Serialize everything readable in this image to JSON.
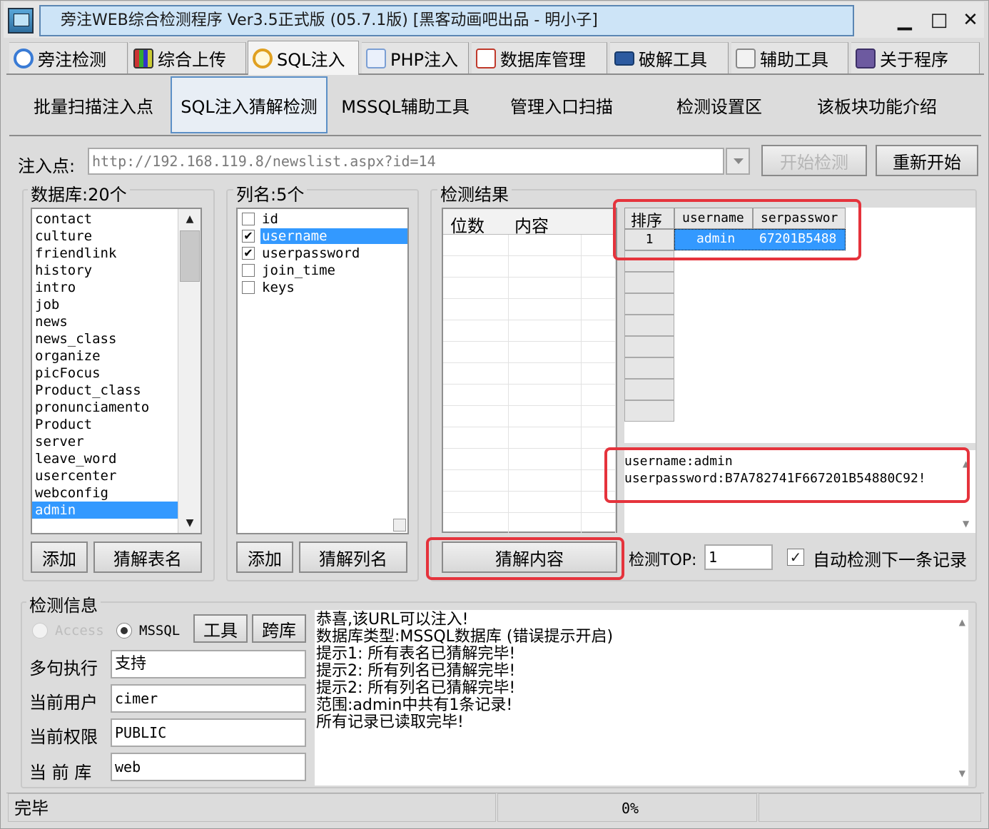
{
  "window": {
    "title": "旁注WEB综合检测程序 Ver3.5正式版 (05.7.1版) [黑客动画吧出品 - 明小子]",
    "minimize": "▁",
    "maximize": "□",
    "close": "✕"
  },
  "main_tabs": [
    {
      "label": "旁注检测",
      "icon_color": "#3a7bd5"
    },
    {
      "label": "综合上传",
      "icon_color": "#4a6fa5"
    },
    {
      "label": "SQL注入",
      "icon_color": "#e0a020"
    },
    {
      "label": "PHP注入",
      "icon_color": "#7b9fd4"
    },
    {
      "label": "数据库管理",
      "icon_color": "#c0392b"
    },
    {
      "label": "破解工具",
      "icon_color": "#2c5aa0"
    },
    {
      "label": "辅助工具",
      "icon_color": "#888888"
    },
    {
      "label": "关于程序",
      "icon_color": "#6d5aa0"
    }
  ],
  "sub_tabs": [
    "批量扫描注入点",
    "SQL注入猜解检测",
    "MSSQL辅助工具",
    "管理入口扫描",
    "检测设置区",
    "该板块功能介绍"
  ],
  "injection": {
    "label": "注入点:",
    "url": "http://192.168.119.8/newslist.aspx?id=14",
    "start_button": "开始检测",
    "restart_button": "重新开始"
  },
  "databases": {
    "title": "数据库:20个",
    "items": [
      "contact",
      "culture",
      "friendlink",
      "history",
      "intro",
      "job",
      "news",
      "news_class",
      "organize",
      "picFocus",
      "Product_class",
      "pronunciamento",
      "Product",
      "server",
      "leave_word",
      "usercenter",
      "webconfig",
      "admin"
    ],
    "selected": "admin",
    "add_button": "添加",
    "guess_button": "猜解表名"
  },
  "columns": {
    "title": "列名:5个",
    "items": [
      {
        "name": "id",
        "checked": false
      },
      {
        "name": "username",
        "checked": true
      },
      {
        "name": "userpassword",
        "checked": true
      },
      {
        "name": "join_time",
        "checked": false
      },
      {
        "name": "keys",
        "checked": false
      }
    ],
    "add_button": "添加",
    "guess_button": "猜解列名"
  },
  "results": {
    "title": "检测结果",
    "left_headers": [
      "位数",
      "内容"
    ],
    "right_headers": [
      "排序",
      "username",
      "serpasswor"
    ],
    "rows": [
      {
        "index": "1",
        "username": "admin",
        "password": "67201B5488"
      }
    ],
    "detail_lines": [
      "username:admin",
      "userpassword:B7A782741F667201B54880C92!"
    ],
    "guess_button": "猜解内容",
    "top_label": "检测TOP:",
    "top_value": "1",
    "auto_label": "自动检测下一条记录",
    "auto_checked": true
  },
  "info": {
    "title": "检测信息",
    "radio_access": "Access",
    "radio_mssql": "MSSQL",
    "selected_db_type": "MSSQL",
    "tool_button": "工具",
    "crossdb_button": "跨库",
    "fields": [
      {
        "label": "多句执行",
        "value": "支持"
      },
      {
        "label": "当前用户",
        "value": "cimer"
      },
      {
        "label": "当前权限",
        "value": "PUBLIC"
      },
      {
        "label": "当 前 库",
        "value": "web"
      }
    ],
    "log": [
      "恭喜,该URL可以注入!",
      "数据库类型:MSSQL数据库 (错误提示开启)",
      "提示1: 所有表名已猜解完毕!",
      "提示2: 所有列名已猜解完毕!",
      "提示2: 所有列名已猜解完毕!",
      "范围:admin中共有1条记录!",
      "所有记录已读取完毕!"
    ]
  },
  "status": {
    "text": "完毕",
    "progress": "0%"
  }
}
